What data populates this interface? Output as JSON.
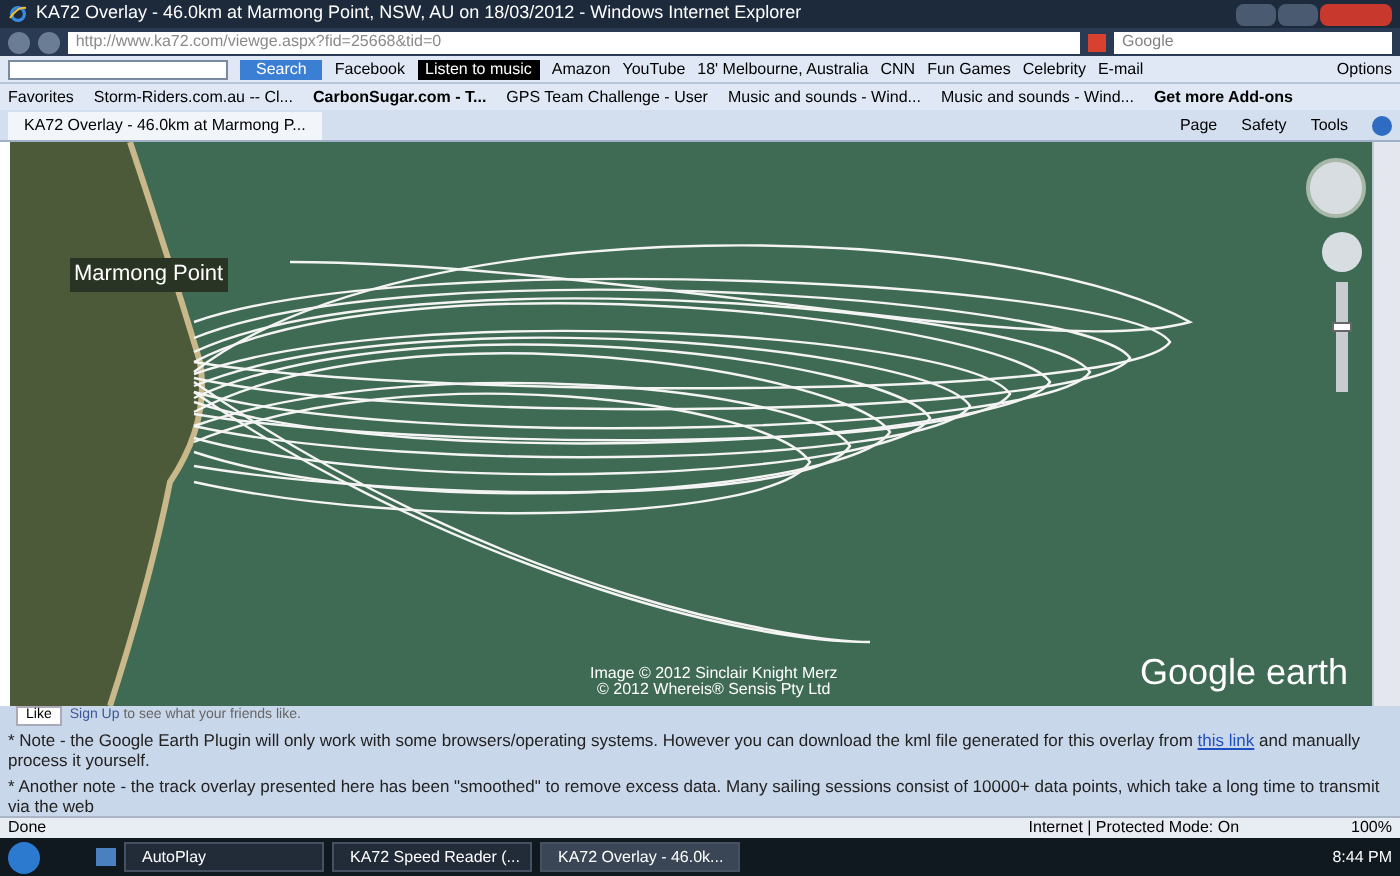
{
  "window": {
    "title": "KA72 Overlay - 46.0km at Marmong Point, NSW, AU on 18/03/2012 - Windows Internet Explorer"
  },
  "address_bar": {
    "url": "http://www.ka72.com/viewge.aspx?fid=25668&tid=0",
    "search_placeholder": "Google"
  },
  "toolbar": {
    "search_button": "Search",
    "items": [
      "Facebook",
      "Listen to music",
      "Amazon",
      "YouTube",
      "18' Melbourne, Australia",
      "CNN",
      "Fun Games",
      "Celebrity",
      "E-mail"
    ],
    "options": "Options"
  },
  "favorites": {
    "label": "Favorites",
    "items": [
      {
        "label": "Storm-Riders.com.au -- Cl...",
        "bold": false
      },
      {
        "label": "CarbonSugar.com - T...",
        "bold": true
      },
      {
        "label": "GPS Team Challenge - User",
        "bold": false
      },
      {
        "label": "Music and sounds - Wind...",
        "bold": false
      },
      {
        "label": "Music and sounds - Wind...",
        "bold": false
      },
      {
        "label": "Get more Add-ons",
        "bold": true
      }
    ]
  },
  "tabs": [
    {
      "label": "KA72 Overlay - 46.0km at Marmong P...",
      "selected": true
    }
  ],
  "command_bar": [
    "Page",
    "Safety",
    "Tools"
  ],
  "map": {
    "place_label": "Marmong Point",
    "credits": [
      "Image © 2012 Sinclair Knight Merz",
      "© 2012 Whereis® Sensis Pty Ltd"
    ],
    "logo": "Google earth",
    "zoom_slider": {
      "level": 0.6
    }
  },
  "like_bar": {
    "button": "Like",
    "text_link": "Sign Up",
    "text": "to see what your friends like."
  },
  "notes": [
    {
      "before": "* Note - the Google Earth Plugin will only work with some browsers/operating systems. However you can download the kml file generated for this overlay from ",
      "link": "this link",
      "after": " and manually process it yourself."
    },
    {
      "before": "* Another note - the track overlay presented here has been \"smoothed\" to remove excess data. Many sailing sessions consist of 10000+ data points, which take a long time to transmit via the web"
    }
  ],
  "status_bar": {
    "text": "Done",
    "zone": "Internet | Protected Mode: On",
    "zoom": "100%"
  },
  "taskbar": {
    "tasks": [
      {
        "label": "AutoPlay",
        "selected": false
      },
      {
        "label": "KA72 Speed Reader (...",
        "selected": false
      },
      {
        "label": "KA72 Overlay - 46.0k...",
        "selected": true
      }
    ],
    "time": "8:44 PM"
  }
}
